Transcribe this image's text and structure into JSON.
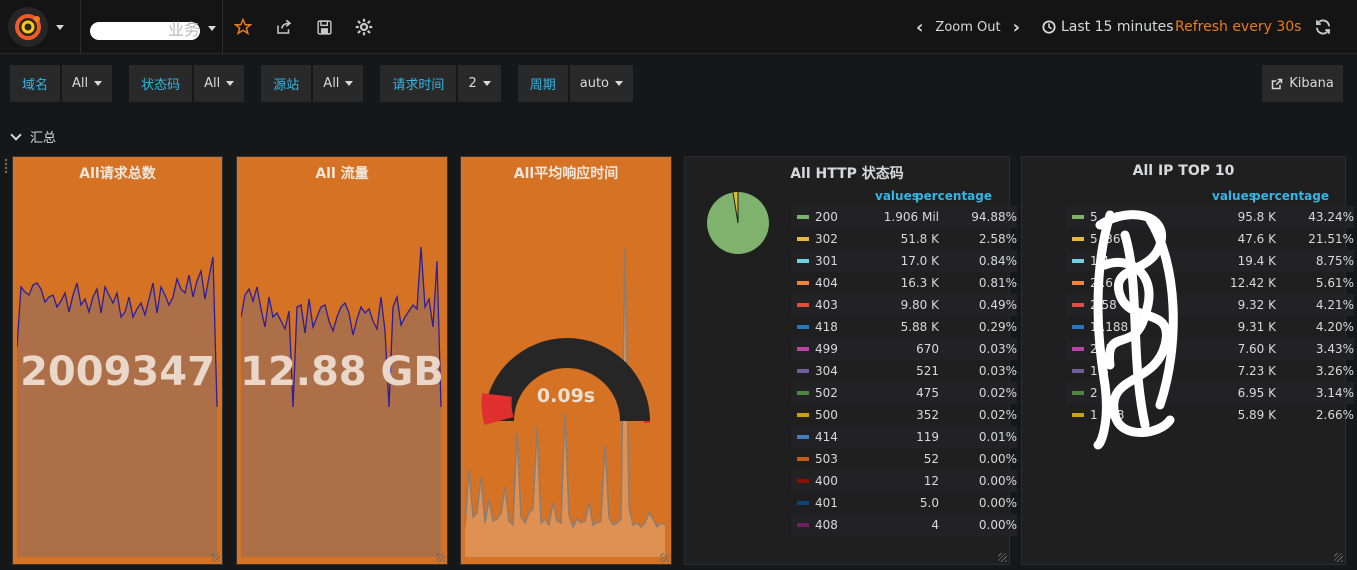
{
  "navbar": {
    "dashboard_title": "业务",
    "zoom_out_label": "Zoom Out",
    "time_range": "Last 15 minutes",
    "refresh_label": "Refresh every 30s"
  },
  "variables": [
    {
      "label": "域名",
      "value": "All",
      "has_caret": true
    },
    {
      "label": "状态码",
      "value": "All",
      "has_caret": true
    },
    {
      "label": "源站",
      "value": "All",
      "has_caret": true
    },
    {
      "label": "请求时间",
      "value": "2",
      "has_caret": true
    },
    {
      "label": "周期",
      "value": "auto",
      "has_caret": true
    }
  ],
  "kibana_label": "Kibana",
  "row_title": "汇总",
  "panels": {
    "total_requests": {
      "title": "All请求总数",
      "value": "2009347"
    },
    "traffic": {
      "title": "All 流量",
      "value": "12.88 GB"
    },
    "avg_response": {
      "title": "All平均响应时间",
      "value": "0.09s"
    },
    "http_status": {
      "title": "All HTTP 状态码",
      "col_values": "values",
      "col_percentage": "percentage",
      "rows": [
        {
          "name": "200",
          "value": "1.906 Mil",
          "pct": "94.88%",
          "color": "#7eb26d"
        },
        {
          "name": "302",
          "value": "51.8 K",
          "pct": "2.58%",
          "color": "#eab839"
        },
        {
          "name": "301",
          "value": "17.0 K",
          "pct": "0.84%",
          "color": "#6ed0e0"
        },
        {
          "name": "404",
          "value": "16.3 K",
          "pct": "0.81%",
          "color": "#ef843c"
        },
        {
          "name": "403",
          "value": "9.80 K",
          "pct": "0.49%",
          "color": "#e24d42"
        },
        {
          "name": "418",
          "value": "5.88 K",
          "pct": "0.29%",
          "color": "#1f78c1"
        },
        {
          "name": "499",
          "value": "670",
          "pct": "0.03%",
          "color": "#ba43a9"
        },
        {
          "name": "304",
          "value": "521",
          "pct": "0.03%",
          "color": "#705da0"
        },
        {
          "name": "502",
          "value": "475",
          "pct": "0.02%",
          "color": "#508642"
        },
        {
          "name": "500",
          "value": "352",
          "pct": "0.02%",
          "color": "#cca300"
        },
        {
          "name": "414",
          "value": "119",
          "pct": "0.01%",
          "color": "#447ebc"
        },
        {
          "name": "503",
          "value": "52",
          "pct": "0.00%",
          "color": "#c15c17"
        },
        {
          "name": "400",
          "value": "12",
          "pct": "0.00%",
          "color": "#890f02"
        },
        {
          "name": "401",
          "value": "5.0",
          "pct": "0.00%",
          "color": "#0a437c"
        },
        {
          "name": "408",
          "value": "4",
          "pct": "0.00%",
          "color": "#6d1f62"
        }
      ]
    },
    "ip_top10": {
      "title": "All IP TOP 10",
      "col_values": "values",
      "col_percentage": "percentage",
      "rows": [
        {
          "name": "5 .46",
          "value": "95.8 K",
          "pct": "43.24%",
          "color": "#7eb26d"
        },
        {
          "name": "5 .36",
          "value": "47.6 K",
          "pct": "21.51%",
          "color": "#eab839"
        },
        {
          "name": "1 4",
          "value": "19.4 K",
          "pct": "8.75%",
          "color": "#6ed0e0"
        },
        {
          "name": "2 .6",
          "value": "12.42 K",
          "pct": "5.61%",
          "color": "#ef843c"
        },
        {
          "name": "2 58",
          "value": "9.32 K",
          "pct": "4.21%",
          "color": "#e24d42"
        },
        {
          "name": "1 .188",
          "value": "9.31 K",
          "pct": "4.20%",
          "color": "#1f78c1"
        },
        {
          "name": "2 .1",
          "value": "7.60 K",
          "pct": "3.43%",
          "color": "#ba43a9"
        },
        {
          "name": "1 3",
          "value": "7.23 K",
          "pct": "3.26%",
          "color": "#705da0"
        },
        {
          "name": "2 6",
          "value": "6.95 K",
          "pct": "3.14%",
          "color": "#508642"
        },
        {
          "name": "1 188",
          "value": "5.89 K",
          "pct": "2.66%",
          "color": "#cca300"
        }
      ]
    }
  },
  "colors": {
    "accent": "#eb7b18",
    "panel_orange": "#d57224",
    "variable_label": "#33b5e5"
  }
}
